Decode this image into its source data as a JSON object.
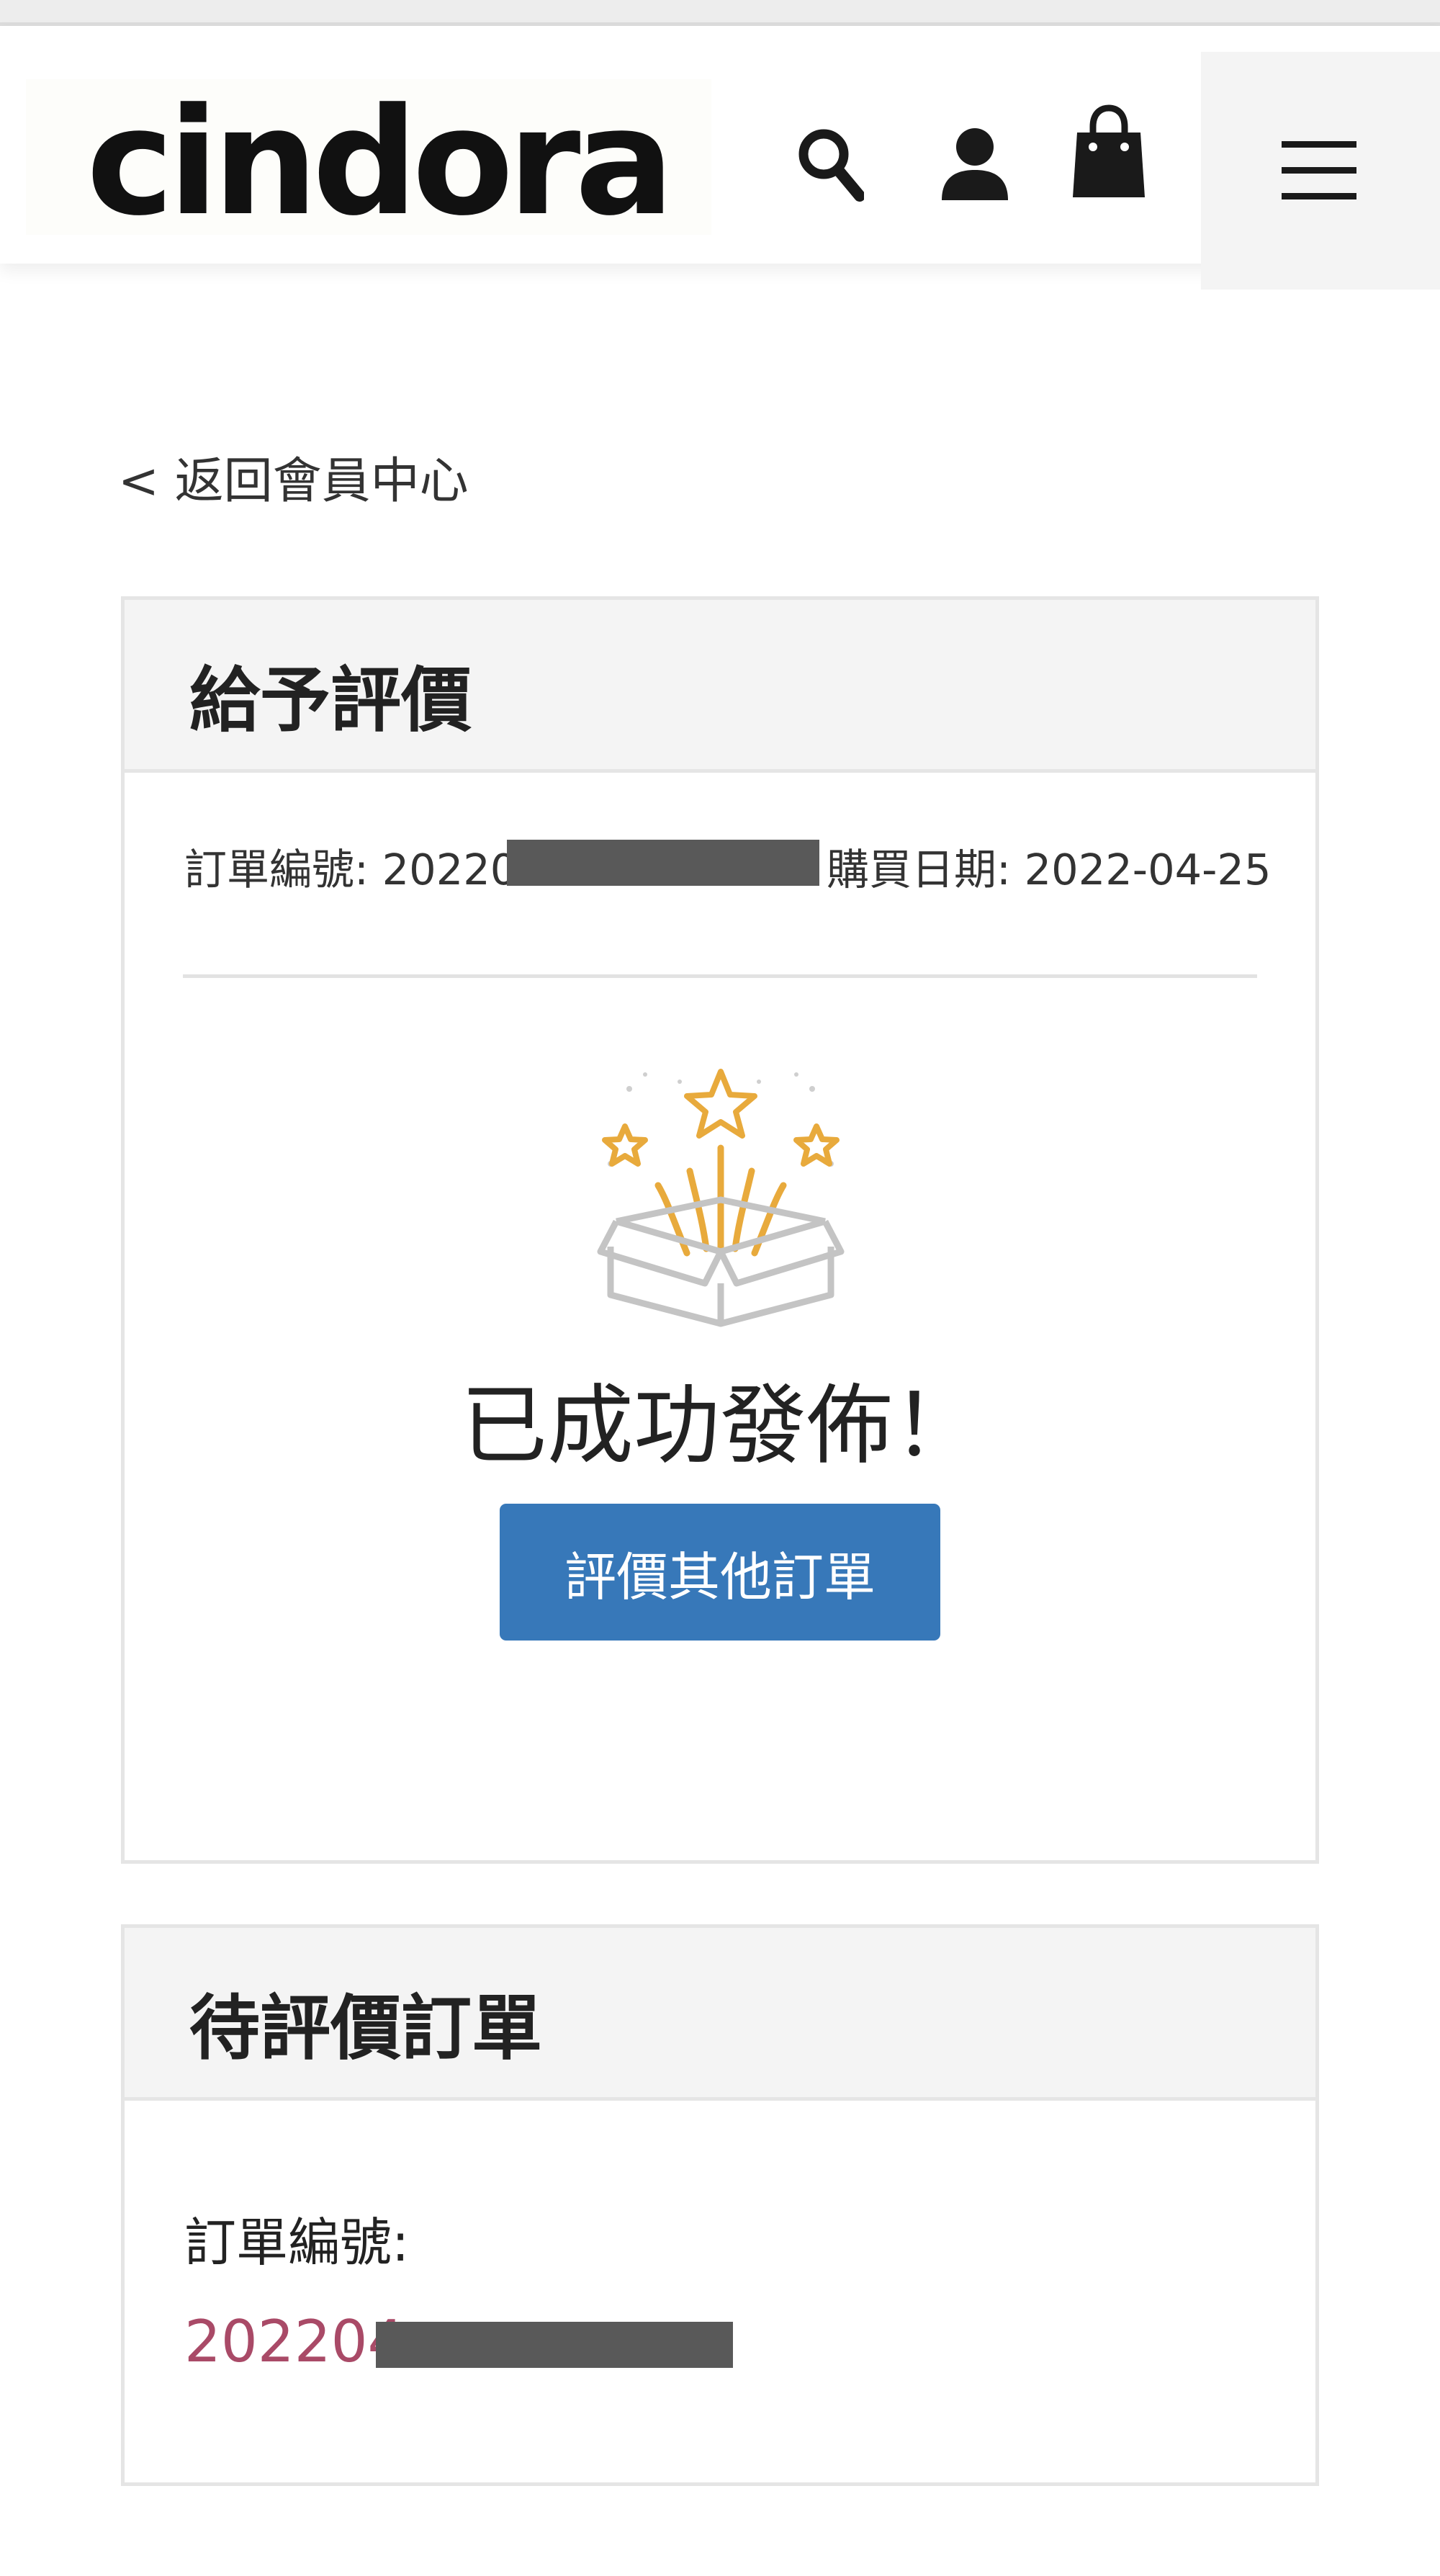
{
  "header": {
    "logo_text": "cindora",
    "icons": [
      "search-icon",
      "user-icon",
      "shopping-bag-icon",
      "hamburger-menu-icon"
    ]
  },
  "nav": {
    "back_label": "< 返回會員中心"
  },
  "review_card": {
    "title": "給予評價",
    "order_no_label": "訂單編號: 20220",
    "purchase_date_label": "購買日期: 2022-04-25",
    "success_message": "已成功發佈！",
    "button_label": "評價其他訂單",
    "success_icon": "gift-box-stars-icon"
  },
  "pending_card": {
    "title": "待評價訂單",
    "order_no_label": "訂單編號:",
    "order_no_value": "202204"
  },
  "colors": {
    "button_bg": "#3778b9",
    "link": "#a94a67",
    "star_accent": "#e8aa3c",
    "redaction": "#595959"
  }
}
